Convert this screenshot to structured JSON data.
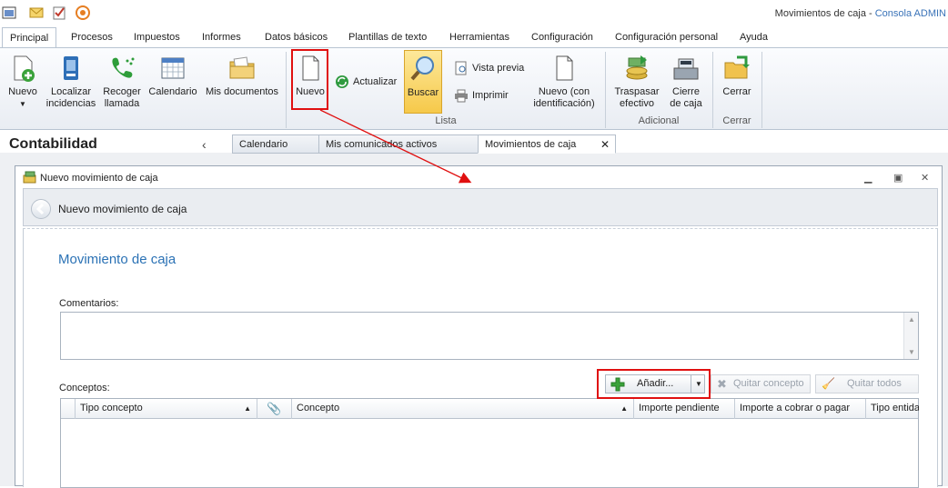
{
  "window": {
    "title": "Movimientos de caja",
    "separator": " - ",
    "app_name": "Consola ADMIN"
  },
  "ribbon_tabs": [
    "Principal",
    "Procesos",
    "Impuestos",
    "Informes",
    "Datos básicos",
    "Plantillas de texto",
    "Herramientas",
    "Configuración",
    "Configuración personal",
    "Ayuda"
  ],
  "ribbon": {
    "nuevo": "Nuevo",
    "localizar_1": "Localizar",
    "localizar_2": "incidencias",
    "recoger_1": "Recoger",
    "recoger_2": "llamada",
    "calendario": "Calendario",
    "mis_documentos": "Mis documentos",
    "nuevo_list": "Nuevo",
    "actualizar": "Actualizar",
    "buscar": "Buscar",
    "vista_previa": "Vista previa",
    "imprimir": "Imprimir",
    "nuevo_con_1": "Nuevo (con",
    "nuevo_con_2": "identificación)",
    "traspasar_1": "Traspasar",
    "traspasar_2": "efectivo",
    "cierre_1": "Cierre",
    "cierre_2": "de caja",
    "cerrar": "Cerrar",
    "group_lista": "Lista",
    "group_adicional": "Adicional",
    "group_cerrar": "Cerrar"
  },
  "panel": {
    "title": "Contabilidad",
    "chevron": "‹"
  },
  "doc_tabs": [
    "Calendario",
    "Mis comunicados activos",
    "Movimientos de caja"
  ],
  "doc_tab_close": "✕",
  "inner_window": {
    "title": "Nuevo movimiento de caja",
    "header": "Nuevo movimiento de caja",
    "section": "Movimiento de caja",
    "comentarios_label": "Comentarios:",
    "comentarios_value": "",
    "conceptos_label": "Conceptos:",
    "add_button": "Añadir...",
    "remove_concept": "Quitar concepto",
    "remove_all": "Quitar todos"
  },
  "grid_columns": [
    "Tipo concepto",
    "Concepto",
    "Importe pendiente",
    "Importe a cobrar o pagar",
    "Tipo entida"
  ],
  "grid_rows": [],
  "colors": {
    "highlight": "#e01010",
    "section_title": "#2b72b5",
    "buscar_active": "#f9d66a"
  }
}
